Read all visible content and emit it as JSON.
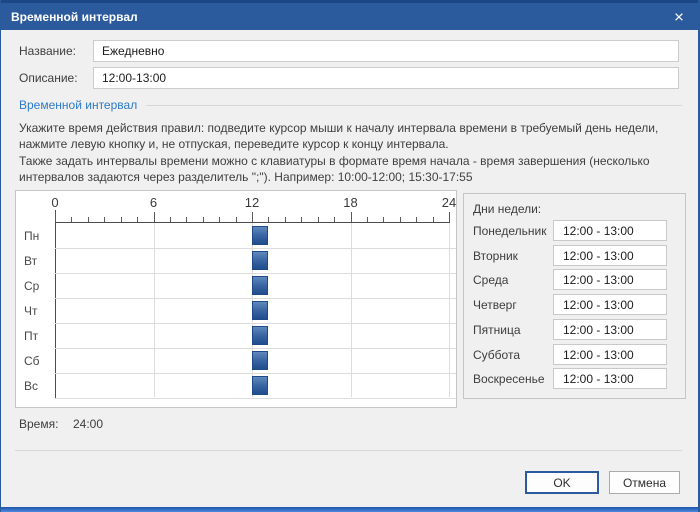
{
  "window": {
    "title": "Временной интервал",
    "close_glyph": "×"
  },
  "fields": {
    "name_label": "Название:",
    "name_value": "Ежедневно",
    "description_label": "Описание:",
    "description_value": "12:00-13:00"
  },
  "section": {
    "header": "Временной интервал",
    "para1": "Укажите время действия правил: подведите курсор мыши к началу интервала времени в требуемый день недели, нажмите левую кнопку и, не отпуская, переведите курсор к концу интервала.",
    "para2": "Также задать интервалы времени можно с клавиатуры в формате время начала - время завершения (несколько интервалов задаются через разделитель \";\"). Например: 10:00-12:00; 15:30-17:55"
  },
  "grid": {
    "hour_labels": [
      "0",
      "6",
      "12",
      "18",
      "24"
    ],
    "hours_total": 24,
    "days": [
      {
        "label": "Пн",
        "intervals": [
          {
            "start": 12,
            "end": 13
          }
        ]
      },
      {
        "label": "Вт",
        "intervals": [
          {
            "start": 12,
            "end": 13
          }
        ]
      },
      {
        "label": "Ср",
        "intervals": [
          {
            "start": 12,
            "end": 13
          }
        ]
      },
      {
        "label": "Чт",
        "intervals": [
          {
            "start": 12,
            "end": 13
          }
        ]
      },
      {
        "label": "Пт",
        "intervals": [
          {
            "start": 12,
            "end": 13
          }
        ]
      },
      {
        "label": "Сб",
        "intervals": [
          {
            "start": 12,
            "end": 13
          }
        ]
      },
      {
        "label": "Вс",
        "intervals": [
          {
            "start": 12,
            "end": 13
          }
        ]
      }
    ]
  },
  "status": {
    "time_label": "Время:",
    "time_value": "24:00"
  },
  "week_panel": {
    "title": "Дни недели:",
    "rows": [
      {
        "day": "Понедельник",
        "value": "12:00 - 13:00"
      },
      {
        "day": "Вторник",
        "value": "12:00 - 13:00"
      },
      {
        "day": "Среда",
        "value": "12:00 - 13:00"
      },
      {
        "day": "Четверг",
        "value": "12:00 - 13:00"
      },
      {
        "day": "Пятница",
        "value": "12:00 - 13:00"
      },
      {
        "day": "Суббота",
        "value": "12:00 - 13:00"
      },
      {
        "day": "Воскресенье",
        "value": "12:00 - 13:00"
      }
    ]
  },
  "buttons": {
    "ok": "OK",
    "cancel": "Отмена"
  },
  "colors": {
    "titlebar": "#2c5b9d",
    "titlebar_top": "#1c4786",
    "accent_blue": "#2e7ac9",
    "block_top": "#6189bd",
    "block_bottom": "#1f4c8c",
    "ok_border": "#2b5b9e",
    "bottom_strip": "#4c89e0"
  }
}
